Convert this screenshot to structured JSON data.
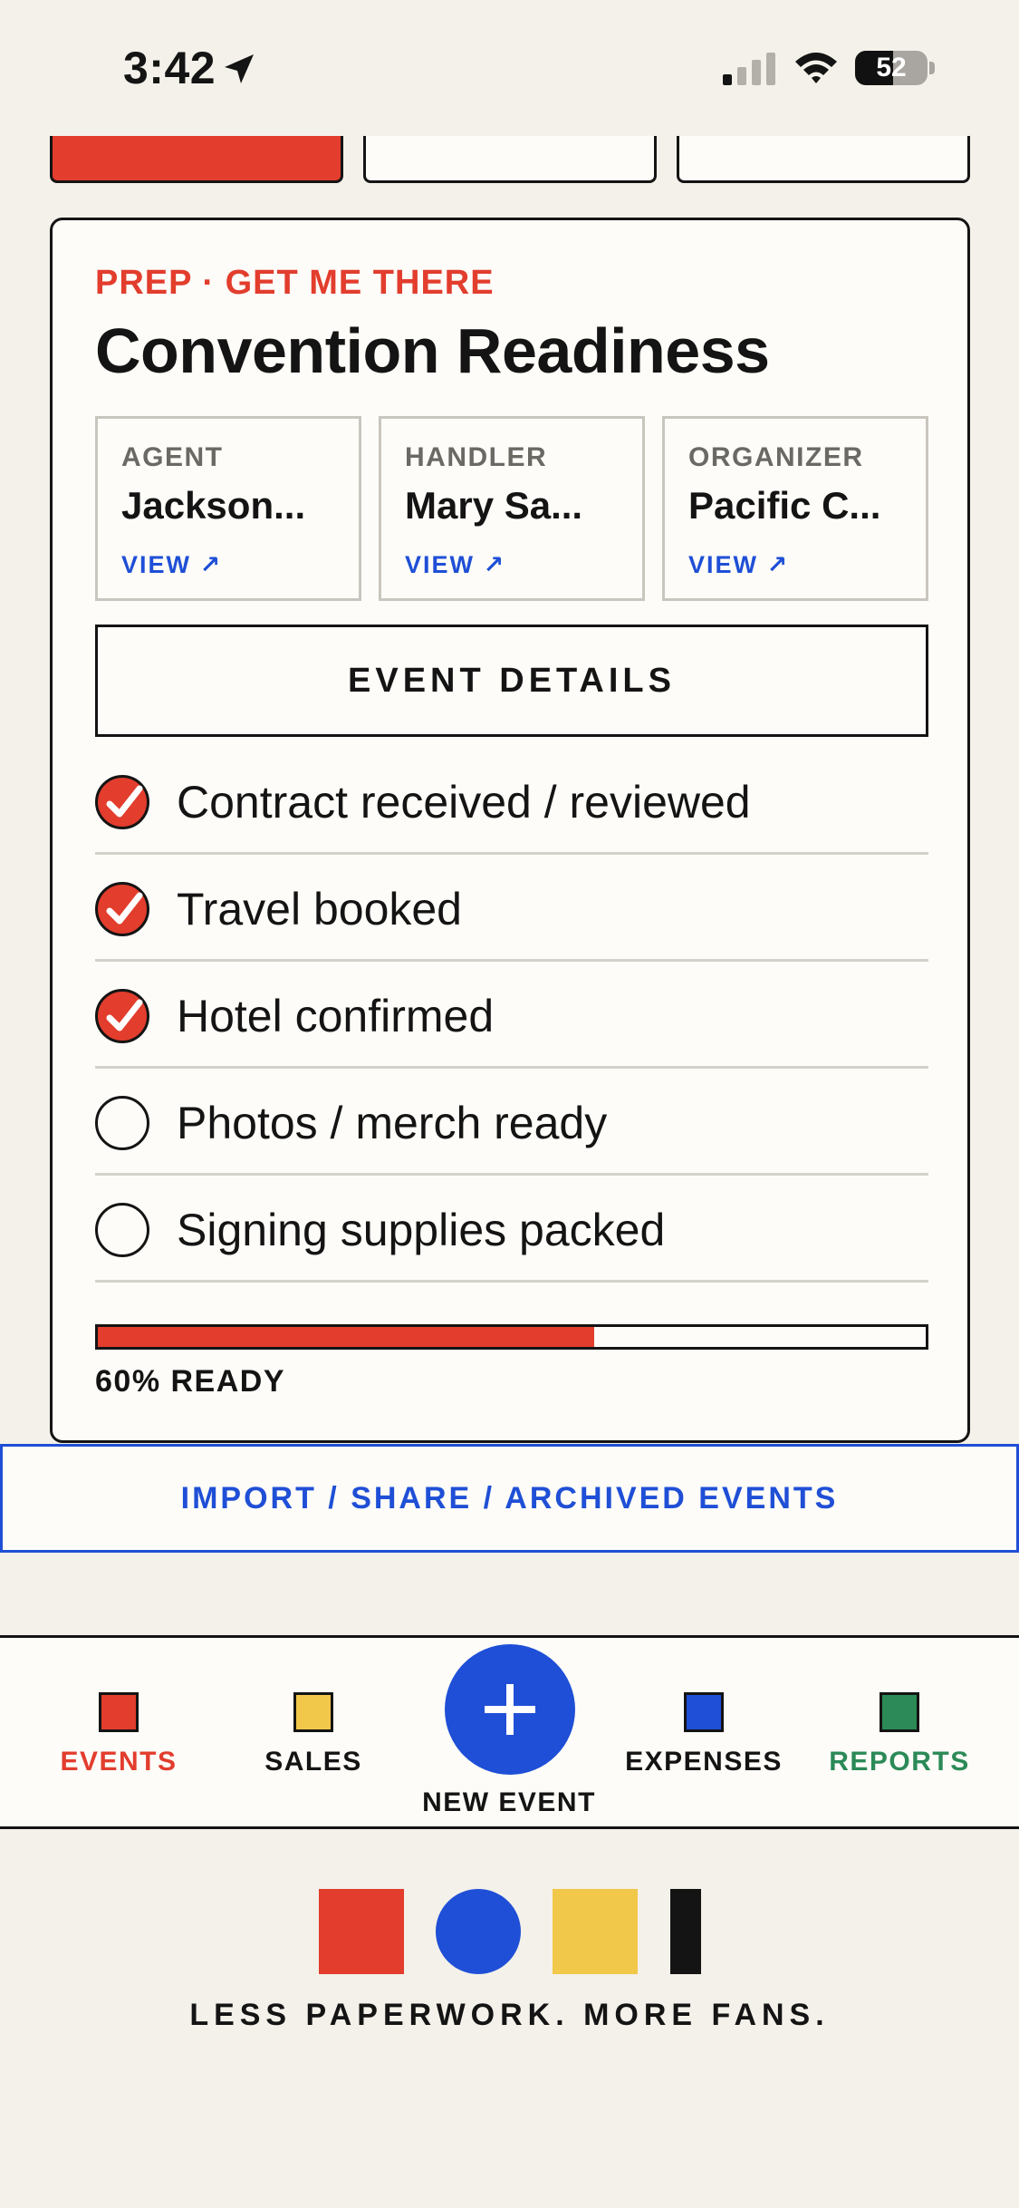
{
  "status_bar": {
    "time": "3:42",
    "battery": "52",
    "battery_level": 0.52
  },
  "tabs": [
    {
      "state": "active"
    },
    {
      "state": "inactive"
    },
    {
      "state": "inactive"
    }
  ],
  "card": {
    "kicker": "PREP · GET ME THERE",
    "title": "Convention Readiness",
    "contacts": [
      {
        "role": "AGENT",
        "name": "Jackson...",
        "link": "VIEW ↗"
      },
      {
        "role": "HANDLER",
        "name": "Mary Sa...",
        "link": "VIEW ↗"
      },
      {
        "role": "ORGANIZER",
        "name": "Pacific C...",
        "link": "VIEW ↗"
      }
    ],
    "details_button": "EVENT DETAILS",
    "checklist": [
      {
        "label": "Contract received / reviewed",
        "done": true
      },
      {
        "label": "Travel booked",
        "done": true
      },
      {
        "label": "Hotel confirmed",
        "done": true
      },
      {
        "label": "Photos / merch ready",
        "done": false
      },
      {
        "label": "Signing supplies packed",
        "done": false
      }
    ],
    "progress": 0.6,
    "progress_label": "60% READY"
  },
  "import_bar": "IMPORT / SHARE / ARCHIVED EVENTS",
  "nav": {
    "items": [
      {
        "label": "EVENTS",
        "color": "#e23d2d",
        "text_color": "#e23d2d",
        "icon": "events-square-icon"
      },
      {
        "label": "SALES",
        "color": "#f2c84b",
        "text_color": "#141414",
        "icon": "sales-square-icon"
      },
      {
        "label": "EXPENSES",
        "color": "#1f4fd6",
        "text_color": "#141414",
        "icon": "expenses-square-icon"
      },
      {
        "label": "REPORTS",
        "color": "#2b8a57",
        "text_color": "#2b8a57",
        "icon": "reports-square-icon"
      }
    ],
    "fab_label": "NEW EVENT",
    "fab_icon": "plus-icon"
  },
  "footer": {
    "tagline": "LESS PAPERWORK. MORE FANS."
  },
  "colors": {
    "red": "#e23d2d",
    "blue": "#1f4fd6",
    "yellow": "#f2c84b",
    "green": "#2b8a57",
    "ink": "#141414",
    "paper": "#f4f1ea"
  }
}
